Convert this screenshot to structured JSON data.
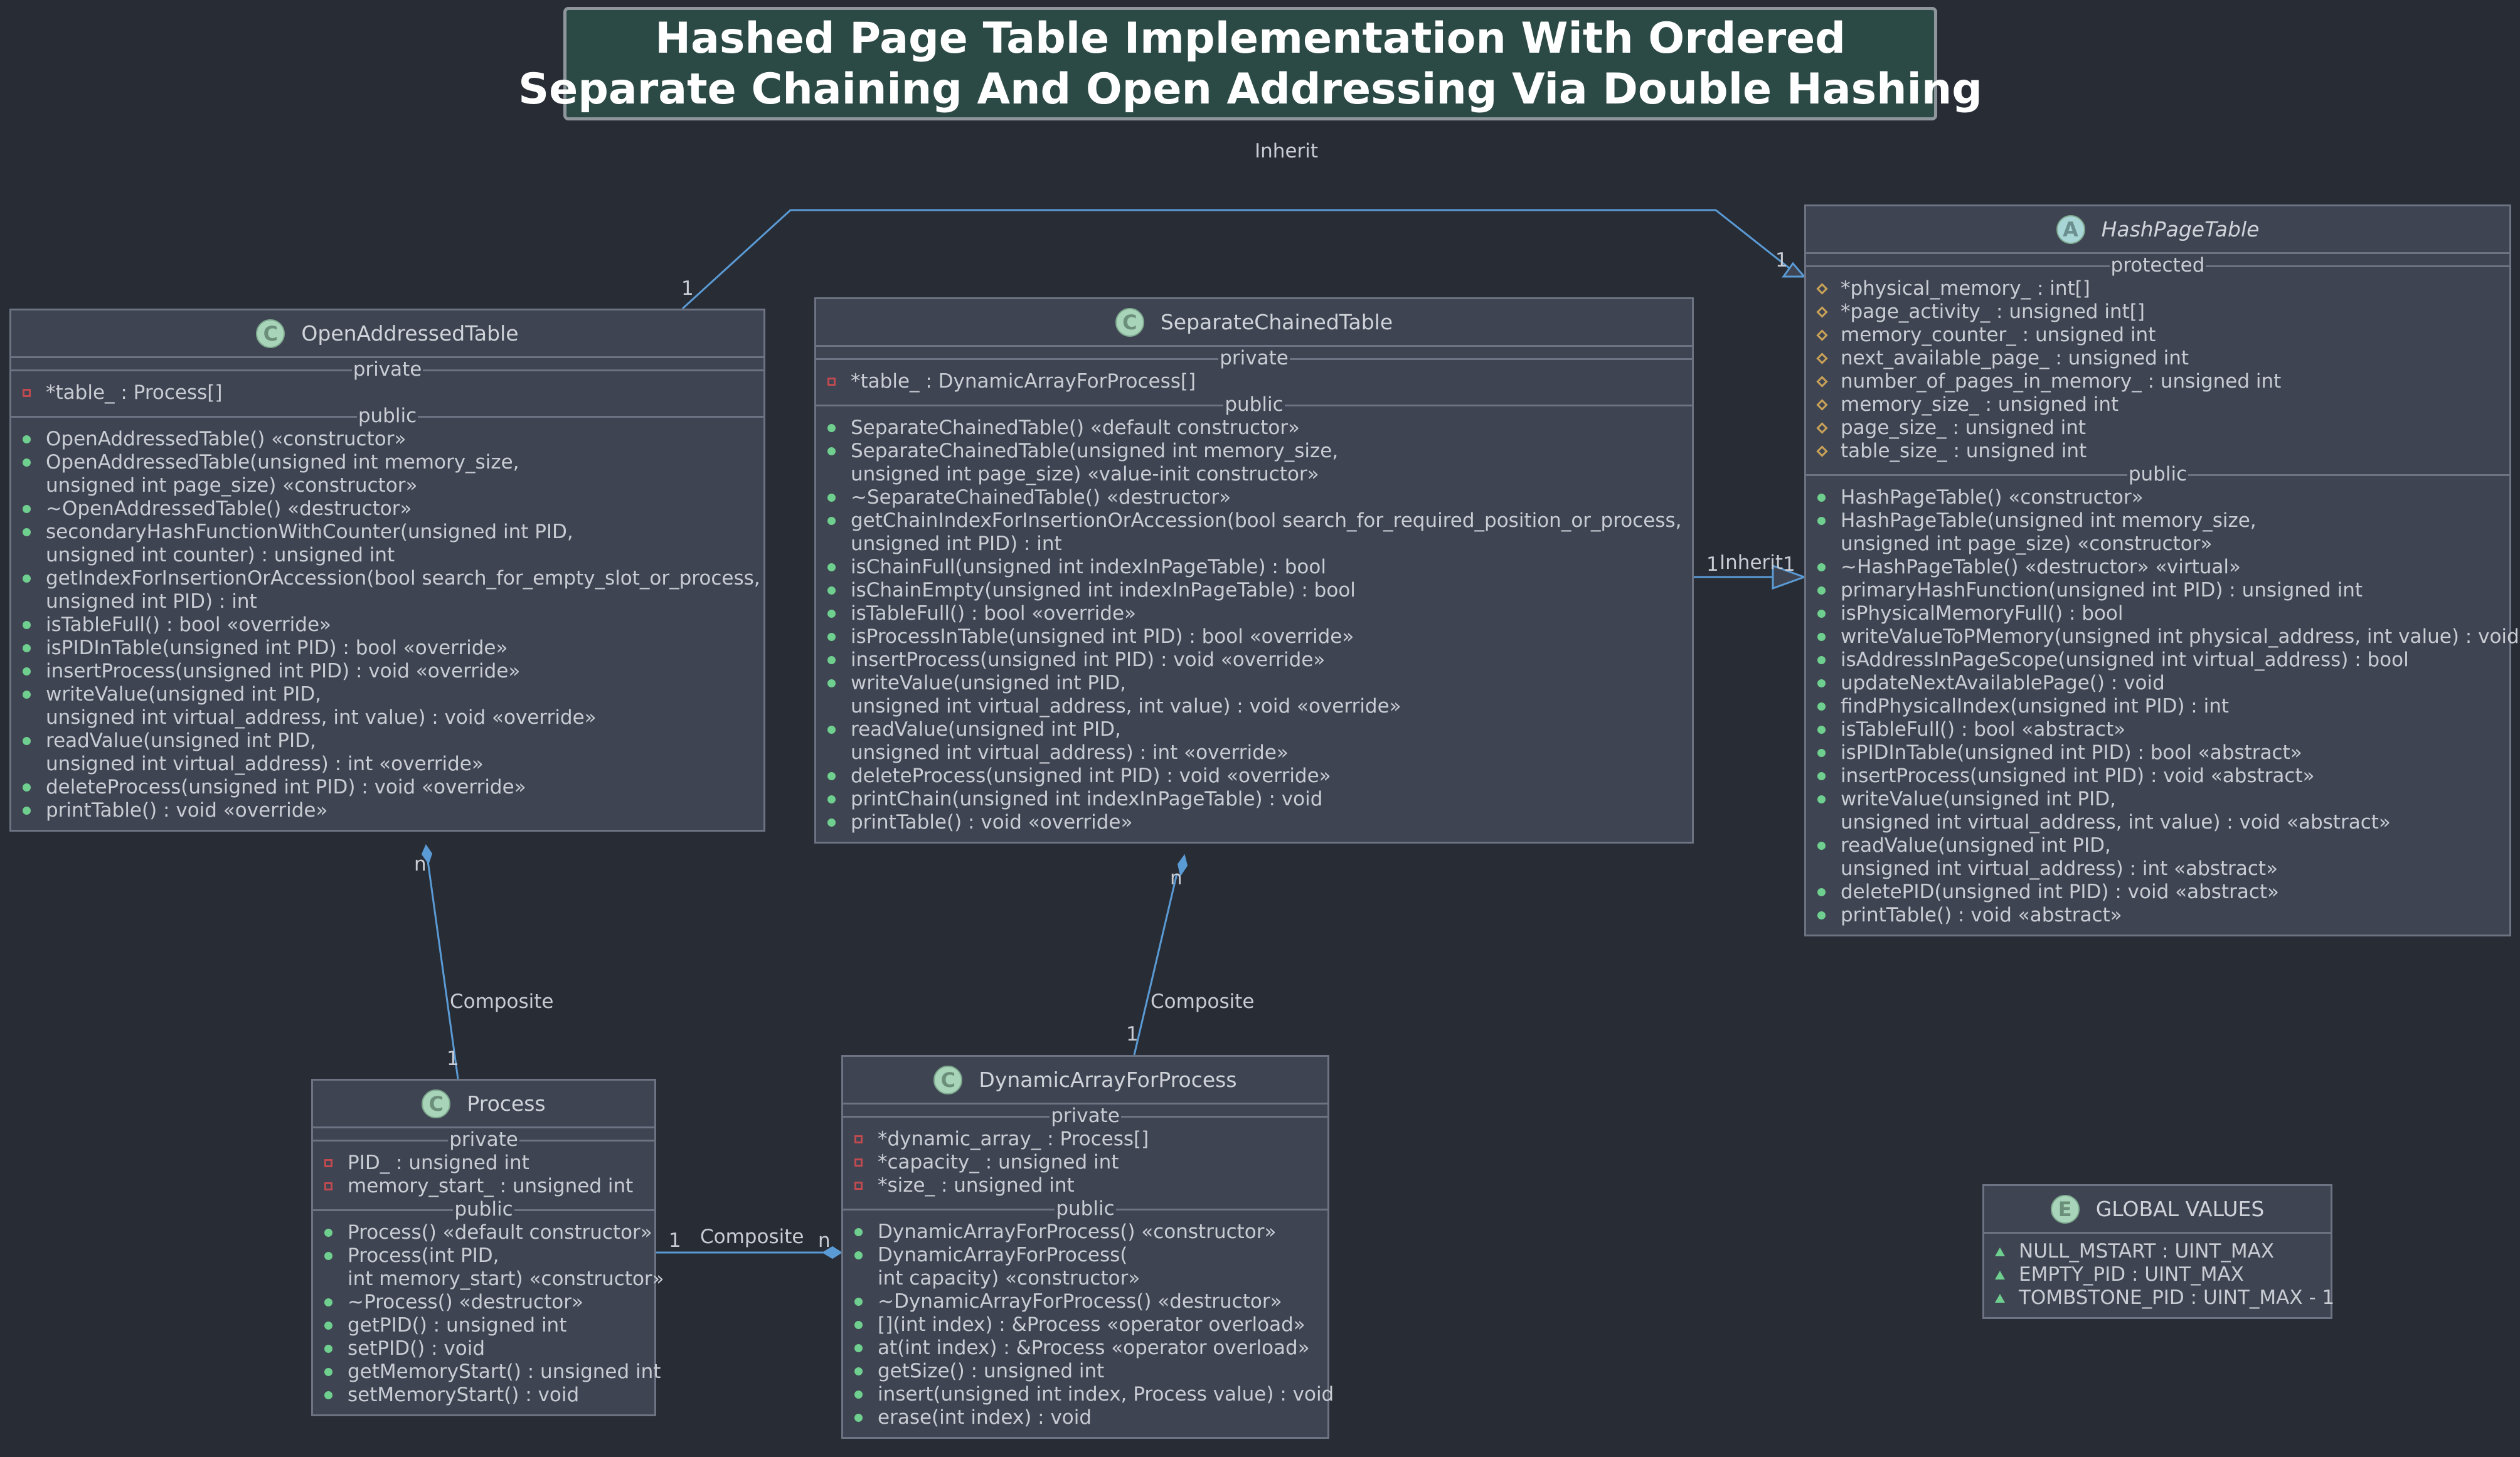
{
  "diagram": {
    "title_lines": [
      "Hashed Page Table Implementation With Ordered",
      "Separate Chaining And Open Addressing Via Double Hashing"
    ],
    "colors": {
      "background": "#272c35",
      "class_fill": "#3e4452",
      "class_border": "#6d7382",
      "title_fill": "#2c4a45",
      "edge": "#5b9bd5",
      "public_marker": "#6fcf8e",
      "private_marker": "#c04a50",
      "protected_marker": "#c9a257"
    },
    "classes": {
      "hash_page_table": {
        "name": "HashPageTable",
        "icon": "abstract-class-icon",
        "icon_letter": "A",
        "sections": [
          {
            "label": "protected",
            "members": [
              {
                "marker": "protected",
                "text": "*physical_memory_ : int[]"
              },
              {
                "marker": "protected",
                "text": "*page_activity_ : unsigned int[]"
              },
              {
                "marker": "protected",
                "text": "memory_counter_ : unsigned int"
              },
              {
                "marker": "protected",
                "text": "next_available_page_ : unsigned int"
              },
              {
                "marker": "protected",
                "text": "number_of_pages_in_memory_ : unsigned int"
              },
              {
                "marker": "protected",
                "text": "memory_size_ : unsigned int"
              },
              {
                "marker": "protected",
                "text": "page_size_ : unsigned int"
              },
              {
                "marker": "protected",
                "text": "table_size_ : unsigned int"
              }
            ]
          },
          {
            "label": "public",
            "members": [
              {
                "marker": "public",
                "text": "HashPageTable() «constructor»"
              },
              {
                "marker": "public",
                "text": "HashPageTable(unsigned int memory_size,"
              },
              {
                "marker": "",
                "text": "unsigned int page_size) «constructor»"
              },
              {
                "marker": "public",
                "text": "~HashPageTable() «destructor» «virtual»"
              },
              {
                "marker": "public",
                "text": "primaryHashFunction(unsigned int PID) : unsigned int"
              },
              {
                "marker": "public",
                "text": "isPhysicalMemoryFull() : bool"
              },
              {
                "marker": "public",
                "text": "writeValueToPMemory(unsigned int physical_address, int value) : void"
              },
              {
                "marker": "public",
                "text": "isAddressInPageScope(unsigned int virtual_address) : bool"
              },
              {
                "marker": "public",
                "text": "updateNextAvailablePage() : void"
              },
              {
                "marker": "public",
                "text": "findPhysicalIndex(unsigned int PID) : int"
              },
              {
                "marker": "public",
                "text": "isTableFull() : bool «abstract»"
              },
              {
                "marker": "public",
                "text": "isPIDInTable(unsigned int PID) : bool «abstract»"
              },
              {
                "marker": "public",
                "text": "insertProcess(unsigned int PID) : void «abstract»"
              },
              {
                "marker": "public",
                "text": "writeValue(unsigned int PID,"
              },
              {
                "marker": "",
                "text": "unsigned int virtual_address, int value) : void «abstract»"
              },
              {
                "marker": "public",
                "text": "readValue(unsigned int PID,"
              },
              {
                "marker": "",
                "text": "unsigned int virtual_address) : int «abstract»"
              },
              {
                "marker": "public",
                "text": "deletePID(unsigned int PID) : void «abstract»"
              },
              {
                "marker": "public",
                "text": "printTable() : void «abstract»"
              }
            ]
          }
        ]
      },
      "open_addressed_table": {
        "name": "OpenAddressedTable",
        "icon": "class-icon",
        "icon_letter": "C",
        "sections": [
          {
            "label": "private",
            "members": [
              {
                "marker": "private",
                "text": "*table_ : Process[]"
              }
            ]
          },
          {
            "label": "public",
            "members": [
              {
                "marker": "public",
                "text": "OpenAddressedTable() «constructor»"
              },
              {
                "marker": "public",
                "text": "OpenAddressedTable(unsigned int memory_size,"
              },
              {
                "marker": "",
                "text": "unsigned int page_size) «constructor»"
              },
              {
                "marker": "public",
                "text": "~OpenAddressedTable() «destructor»"
              },
              {
                "marker": "public",
                "text": "secondaryHashFunctionWithCounter(unsigned int PID,"
              },
              {
                "marker": "",
                "text": "unsigned int counter) : unsigned int"
              },
              {
                "marker": "public",
                "text": "getIndexForInsertionOrAccession(bool search_for_empty_slot_or_process,"
              },
              {
                "marker": "",
                "text": "unsigned int PID) : int"
              },
              {
                "marker": "public",
                "text": "isTableFull() : bool «override»"
              },
              {
                "marker": "public",
                "text": "isPIDInTable(unsigned int PID) : bool «override»"
              },
              {
                "marker": "public",
                "text": "insertProcess(unsigned int PID) : void «override»"
              },
              {
                "marker": "public",
                "text": "writeValue(unsigned int PID,"
              },
              {
                "marker": "",
                "text": "unsigned int virtual_address, int value) : void «override»"
              },
              {
                "marker": "public",
                "text": "readValue(unsigned int PID,"
              },
              {
                "marker": "",
                "text": "unsigned int virtual_address) : int «override»"
              },
              {
                "marker": "public",
                "text": "deleteProcess(unsigned int PID) : void «override»"
              },
              {
                "marker": "public",
                "text": "printTable() : void «override»"
              }
            ]
          }
        ]
      },
      "separate_chained_table": {
        "name": "SeparateChainedTable",
        "icon": "class-icon",
        "icon_letter": "C",
        "sections": [
          {
            "label": "private",
            "members": [
              {
                "marker": "private",
                "text": "*table_ : DynamicArrayForProcess[]"
              }
            ]
          },
          {
            "label": "public",
            "members": [
              {
                "marker": "public",
                "text": "SeparateChainedTable() «default constructor»"
              },
              {
                "marker": "public",
                "text": "SeparateChainedTable(unsigned int memory_size,"
              },
              {
                "marker": "",
                "text": "unsigned int page_size) «value-init constructor»"
              },
              {
                "marker": "public",
                "text": "~SeparateChainedTable() «destructor»"
              },
              {
                "marker": "public",
                "text": "getChainIndexForInsertionOrAccession(bool search_for_required_position_or_process,"
              },
              {
                "marker": "",
                "text": "unsigned int PID) : int"
              },
              {
                "marker": "public",
                "text": "isChainFull(unsigned int indexInPageTable) : bool"
              },
              {
                "marker": "public",
                "text": "isChainEmpty(unsigned int indexInPageTable) : bool"
              },
              {
                "marker": "public",
                "text": "isTableFull() : bool «override»"
              },
              {
                "marker": "public",
                "text": "isProcessInTable(unsigned int PID) : bool «override»"
              },
              {
                "marker": "public",
                "text": "insertProcess(unsigned int PID) : void «override»"
              },
              {
                "marker": "public",
                "text": "writeValue(unsigned int PID,"
              },
              {
                "marker": "",
                "text": "unsigned int virtual_address, int value) : void «override»"
              },
              {
                "marker": "public",
                "text": "readValue(unsigned int PID,"
              },
              {
                "marker": "",
                "text": "unsigned int virtual_address) : int «override»"
              },
              {
                "marker": "public",
                "text": "deleteProcess(unsigned int PID) : void «override»"
              },
              {
                "marker": "public",
                "text": "printChain(unsigned int indexInPageTable) : void"
              },
              {
                "marker": "public",
                "text": "printTable() : void «override»"
              }
            ]
          }
        ]
      },
      "process": {
        "name": "Process",
        "icon": "class-icon",
        "icon_letter": "C",
        "sections": [
          {
            "label": "private",
            "members": [
              {
                "marker": "private",
                "text": "PID_ : unsigned int"
              },
              {
                "marker": "private",
                "text": "memory_start_ : unsigned int"
              }
            ]
          },
          {
            "label": "public",
            "members": [
              {
                "marker": "public",
                "text": "Process() «default constructor»"
              },
              {
                "marker": "public",
                "text": "Process(int PID,"
              },
              {
                "marker": "",
                "text": "int memory_start) «constructor»"
              },
              {
                "marker": "public",
                "text": "~Process() «destructor»"
              },
              {
                "marker": "public",
                "text": "getPID() : unsigned int"
              },
              {
                "marker": "public",
                "text": "setPID() : void"
              },
              {
                "marker": "public",
                "text": "getMemoryStart() : unsigned int"
              },
              {
                "marker": "public",
                "text": "setMemoryStart() : void"
              }
            ]
          }
        ]
      },
      "dynamic_array_for_process": {
        "name": "DynamicArrayForProcess",
        "icon": "class-icon",
        "icon_letter": "C",
        "sections": [
          {
            "label": "private",
            "members": [
              {
                "marker": "private",
                "text": "*dynamic_array_ : Process[]"
              },
              {
                "marker": "private",
                "text": "*capacity_ : unsigned int"
              },
              {
                "marker": "private",
                "text": "*size_ : unsigned int"
              }
            ]
          },
          {
            "label": "public",
            "members": [
              {
                "marker": "public",
                "text": "DynamicArrayForProcess() «constructor»"
              },
              {
                "marker": "public",
                "text": "DynamicArrayForProcess("
              },
              {
                "marker": "",
                "text": "int capacity) «constructor»"
              },
              {
                "marker": "public",
                "text": "~DynamicArrayForProcess() «destructor»"
              },
              {
                "marker": "public",
                "text": "[](int index) : &Process «operator overload»"
              },
              {
                "marker": "public",
                "text": "at(int index) : &Process «operator overload»"
              },
              {
                "marker": "public",
                "text": "getSize() : unsigned int"
              },
              {
                "marker": "public",
                "text": "insert(unsigned int index, Process value) : void"
              },
              {
                "marker": "public",
                "text": "erase(int index) : void"
              }
            ]
          }
        ]
      },
      "global_values": {
        "name": "GLOBAL VALUES",
        "icon": "enum-icon",
        "icon_letter": "E",
        "sections": [
          {
            "label": "",
            "members": [
              {
                "marker": "enum",
                "text": "NULL_MSTART : UINT_MAX"
              },
              {
                "marker": "enum",
                "text": "EMPTY_PID : UINT_MAX"
              },
              {
                "marker": "enum",
                "text": "TOMBSTONE_PID : UINT_MAX - 1"
              }
            ]
          }
        ]
      }
    },
    "edges": {
      "oat_inherit": {
        "label": "Inherit",
        "from_mult": "1",
        "to_mult": "1"
      },
      "sct_inherit": {
        "label": "Inherit",
        "from_mult": "1",
        "to_mult": "1"
      },
      "oat_process": {
        "label": "Composite",
        "from_mult": "n",
        "to_mult": "1"
      },
      "sct_dyn": {
        "label": "Composite",
        "from_mult": "n",
        "to_mult": "1"
      },
      "process_dyn": {
        "label": "Composite",
        "from_mult": "1",
        "to_mult": "n"
      }
    }
  }
}
